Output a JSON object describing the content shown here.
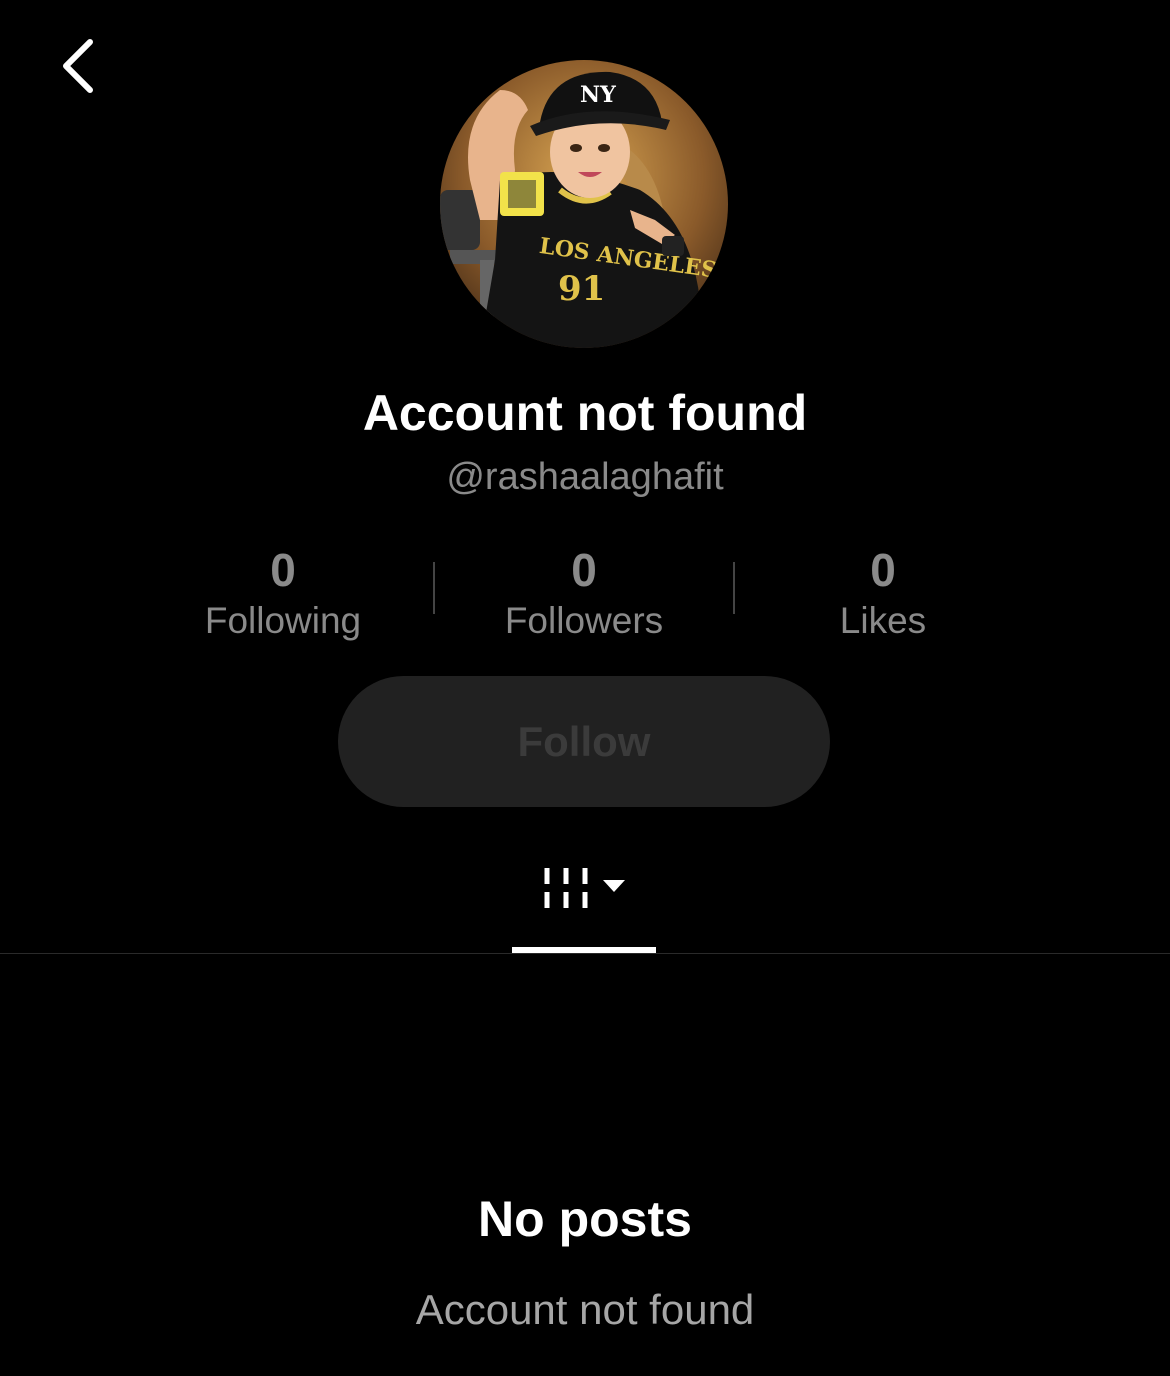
{
  "header": {
    "back_icon": "chevron-left-icon"
  },
  "profile": {
    "avatar_icon": "avatar-illustration",
    "title": "Account not found",
    "handle": "@rashaalaghafit"
  },
  "stats": [
    {
      "value": "0",
      "label": "Following"
    },
    {
      "value": "0",
      "label": "Followers"
    },
    {
      "value": "0",
      "label": "Likes"
    }
  ],
  "follow_button": {
    "label": "Follow",
    "state": "disabled"
  },
  "tabs": {
    "active_icon": "grid-videos-icon",
    "dropdown_icon": "caret-down-icon"
  },
  "empty_state": {
    "title": "No posts",
    "subtitle": "Account not found"
  },
  "colors": {
    "background": "#000000",
    "text_primary": "#ffffff",
    "text_muted": "#8a8a8a",
    "button_bg": "#212121",
    "button_text": "#3b3b3b"
  }
}
